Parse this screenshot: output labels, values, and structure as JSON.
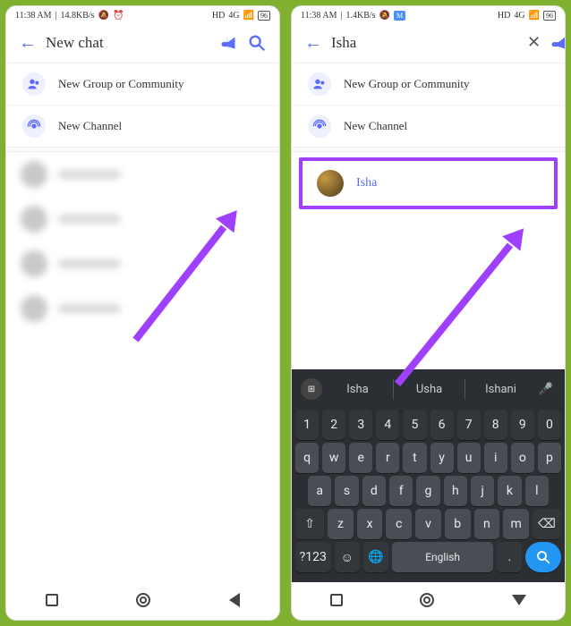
{
  "status": {
    "time": "11:38 AM",
    "net_left": "14.8KB/s",
    "net_right": "1.4KB/s",
    "hd": "HD",
    "sig": "4G",
    "batt": "96"
  },
  "left": {
    "header": {
      "title": "New chat"
    },
    "options": {
      "group": "New Group or Community",
      "channel": "New Channel"
    }
  },
  "right": {
    "header": {
      "query": "Isha"
    },
    "options": {
      "group": "New Group or Community",
      "channel": "New Channel"
    },
    "result": {
      "name": "Isha"
    },
    "keyboard": {
      "suggestions": [
        "Isha",
        "Usha",
        "Ishani"
      ],
      "nums": [
        "1",
        "2",
        "3",
        "4",
        "5",
        "6",
        "7",
        "8",
        "9",
        "0"
      ],
      "row1": [
        "q",
        "w",
        "e",
        "r",
        "t",
        "y",
        "u",
        "i",
        "o",
        "p"
      ],
      "row2": [
        "a",
        "s",
        "d",
        "f",
        "g",
        "h",
        "j",
        "k",
        "l"
      ],
      "row3": [
        "z",
        "x",
        "c",
        "v",
        "b",
        "n",
        "m"
      ],
      "sym": "?123",
      "lang": "English"
    }
  }
}
